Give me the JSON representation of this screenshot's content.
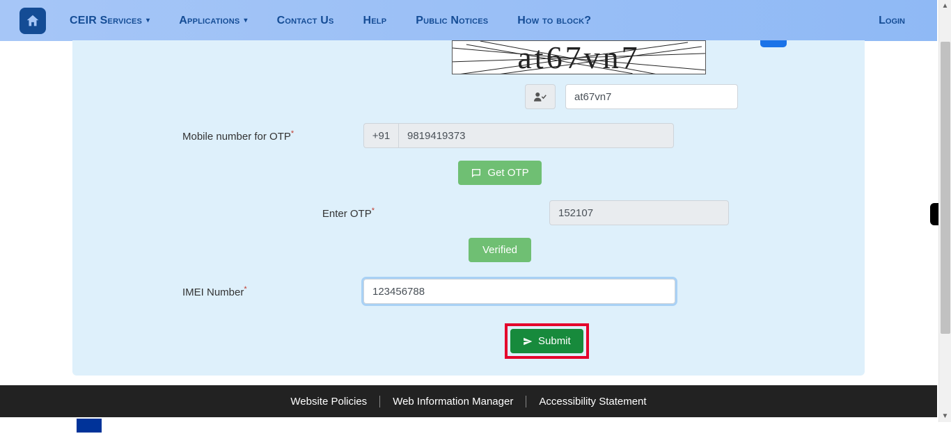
{
  "nav": {
    "items": [
      {
        "label": "CEIR Services",
        "dropdown": true
      },
      {
        "label": "Applications",
        "dropdown": true
      },
      {
        "label": "Contact Us",
        "dropdown": false
      },
      {
        "label": "Help",
        "dropdown": false
      },
      {
        "label": "Public Notices",
        "dropdown": false
      },
      {
        "label": "How to block?",
        "dropdown": false
      }
    ],
    "login": "Login"
  },
  "form": {
    "captcha_text": "at67vn7",
    "captcha_value": "at67vn7",
    "mobile_label": "Mobile number for OTP",
    "country_code": "+91",
    "mobile_value": "9819419373",
    "get_otp_label": "Get OTP",
    "enter_otp_label": "Enter OTP",
    "otp_value": "152107",
    "verified_label": "Verified",
    "imei_label": "IMEI Number",
    "imei_value": "123456788",
    "submit_label": "Submit"
  },
  "footer": {
    "links": [
      "Website Policies",
      "Web Information Manager",
      "Accessibility Statement"
    ]
  }
}
